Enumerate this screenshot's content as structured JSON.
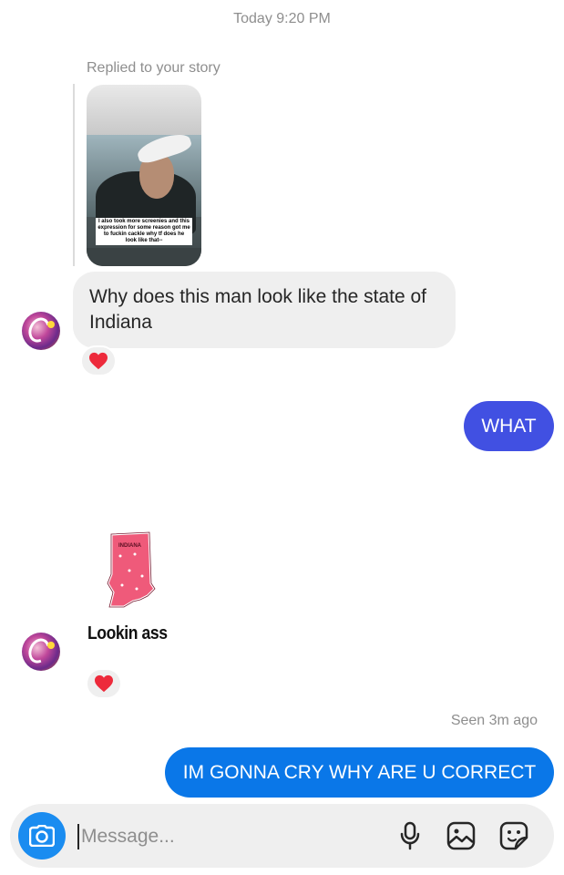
{
  "thread": {
    "timestamp": "Today 9:20 PM",
    "reply_label": "Replied to your story",
    "story_caption": "I also took more screenies and this expression for some reason got me to fuckin cackle why tf does he look like that--"
  },
  "messages": {
    "incoming_1": "Why does this man look like the state of Indiana",
    "outgoing_1": "WHAT",
    "sticker_text": "Lookin ass",
    "sticker_map_label": "INDIANA",
    "seen_status": "Seen 3m ago",
    "outgoing_2": "IM GONNA CRY WHY ARE U CORRECT"
  },
  "reactions": {
    "reaction_1": "heart-icon",
    "reaction_2": "heart-icon"
  },
  "composer": {
    "placeholder": "Message...",
    "icons": [
      "camera-icon",
      "microphone-icon",
      "gallery-icon",
      "sticker-icon"
    ]
  },
  "colors": {
    "outgoing_purple": "#4150e2",
    "outgoing_blue": "#0a77e8",
    "camera_button": "#1a8cf0",
    "incoming_bubble": "#efefef",
    "heart": "#ed2a3b",
    "indiana_pink": "#ef5a7a"
  }
}
